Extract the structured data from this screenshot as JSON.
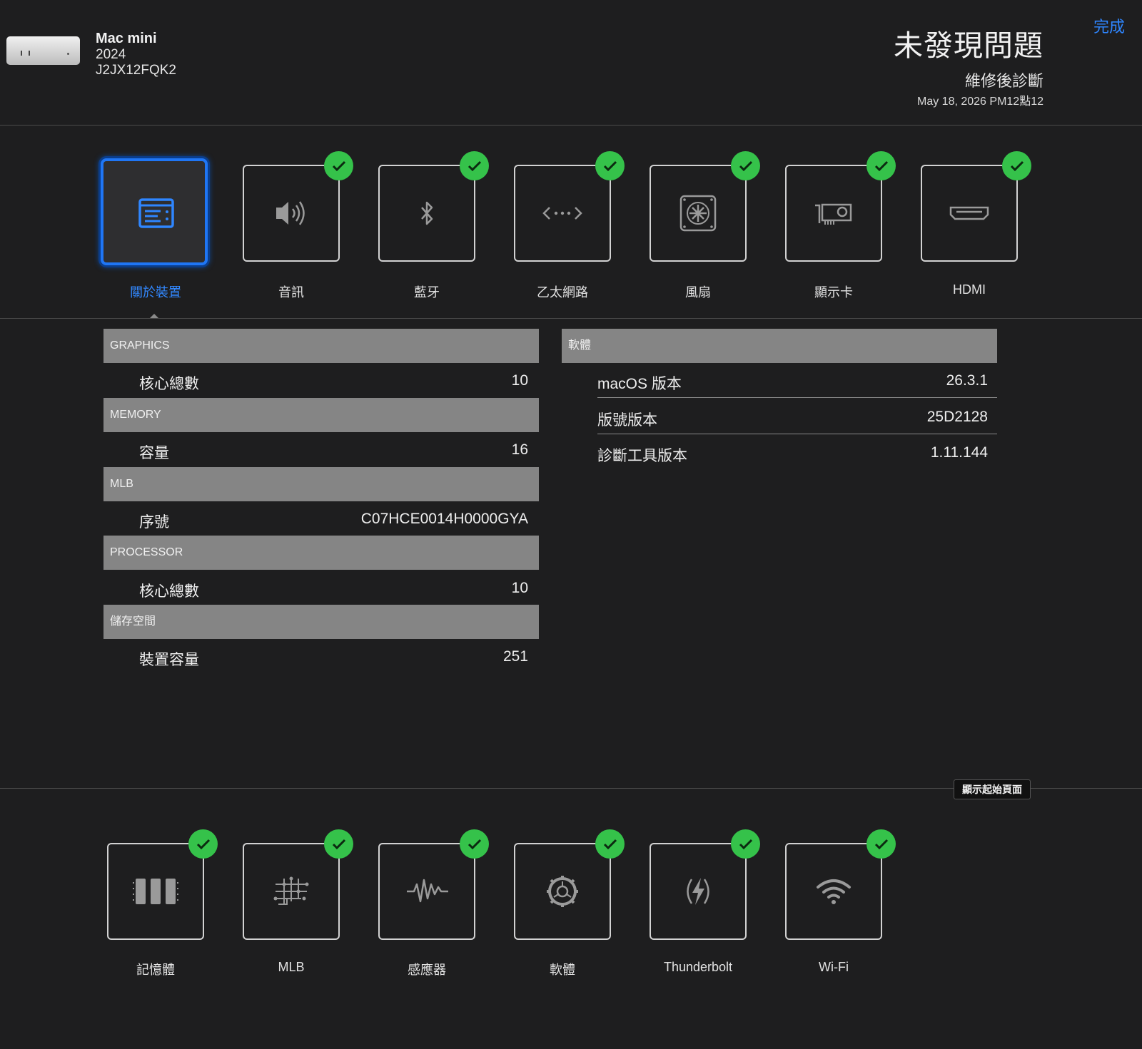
{
  "header": {
    "device_name": "Mac mini",
    "device_year": "2024",
    "device_serial": "J2JX12FQK2",
    "result_title": "未發現問題",
    "result_subtitle": "維修後診斷",
    "result_date": "May 18, 2026 PM12點12",
    "done_label": "完成"
  },
  "top_tiles": [
    {
      "label": "關於裝置",
      "icon": "info-panel-icon",
      "selected": true,
      "passed": false
    },
    {
      "label": "音訊",
      "icon": "speaker-icon",
      "selected": false,
      "passed": true
    },
    {
      "label": "藍牙",
      "icon": "bluetooth-icon",
      "selected": false,
      "passed": true
    },
    {
      "label": "乙太網路",
      "icon": "ethernet-icon",
      "selected": false,
      "passed": true
    },
    {
      "label": "風扇",
      "icon": "fan-icon",
      "selected": false,
      "passed": true
    },
    {
      "label": "顯示卡",
      "icon": "graphics-card-icon",
      "selected": false,
      "passed": true
    },
    {
      "label": "HDMI",
      "icon": "hdmi-icon",
      "selected": false,
      "passed": true
    }
  ],
  "hardware_sections": [
    {
      "header": "GRAPHICS",
      "label": "核心總數",
      "value": "10"
    },
    {
      "header": "MEMORY",
      "label": "容量",
      "value": "16"
    },
    {
      "header": "MLB",
      "label": "序號",
      "value": "C07HCE0014H0000GYA"
    },
    {
      "header": "PROCESSOR",
      "label": "核心總數",
      "value": "10"
    },
    {
      "header": "儲存空間",
      "label": "裝置容量",
      "value": "251"
    }
  ],
  "software": {
    "header": "軟體",
    "rows": [
      {
        "label": "macOS 版本",
        "value": "26.3.1"
      },
      {
        "label": "版號版本",
        "value": "25D2128"
      },
      {
        "label": "診斷工具版本",
        "value": "1.11.144"
      }
    ]
  },
  "home_button_label": "顯示起始頁面",
  "bottom_tiles": [
    {
      "label": "記憶體",
      "icon": "memory-icon",
      "passed": true
    },
    {
      "label": "MLB",
      "icon": "logic-board-icon",
      "passed": true
    },
    {
      "label": "感應器",
      "icon": "sensor-waveform-icon",
      "passed": true
    },
    {
      "label": "軟體",
      "icon": "software-gear-icon",
      "passed": true
    },
    {
      "label": "Thunderbolt",
      "icon": "thunderbolt-icon",
      "passed": true
    },
    {
      "label": "Wi-Fi",
      "icon": "wifi-icon",
      "passed": true
    }
  ],
  "colors": {
    "accent": "#2f86ff",
    "check": "#35c24a",
    "section_header": "#858585",
    "background": "#1e1e1f"
  }
}
